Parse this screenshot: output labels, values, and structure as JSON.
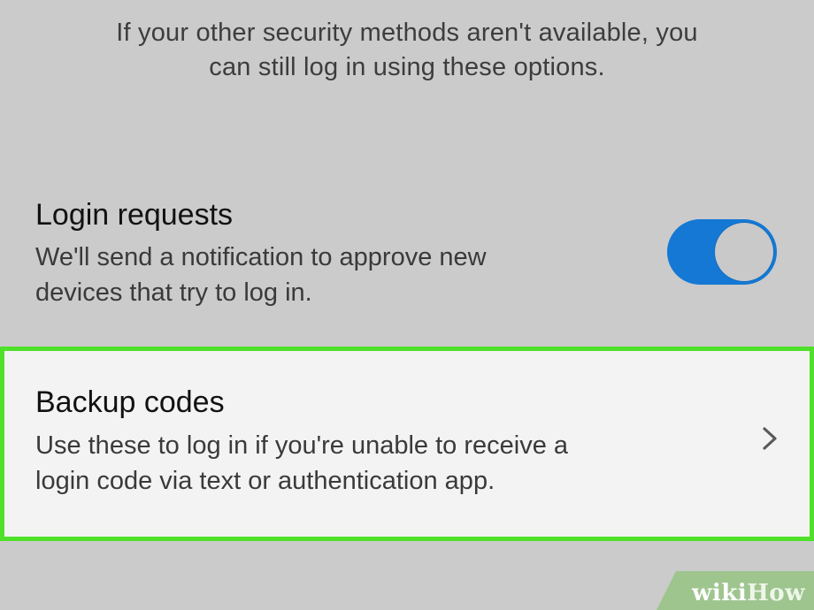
{
  "intro": {
    "line1": "If your other security methods aren't available, you",
    "line2": "can still log in using these options."
  },
  "login_requests": {
    "title": "Login requests",
    "desc_line1": "We'll send a notification to approve new",
    "desc_line2": "devices that try to log in.",
    "toggle_state": "on",
    "toggle_color": "#1478d4"
  },
  "backup_codes": {
    "title": "Backup codes",
    "desc_line1": "Use these to log in if you're unable to receive a",
    "desc_line2": "login code via text or authentication app.",
    "highlight_color": "#4fe02a",
    "icon": "chevron-right-icon"
  },
  "watermark": {
    "wiki": "wiki",
    "how": "How"
  }
}
